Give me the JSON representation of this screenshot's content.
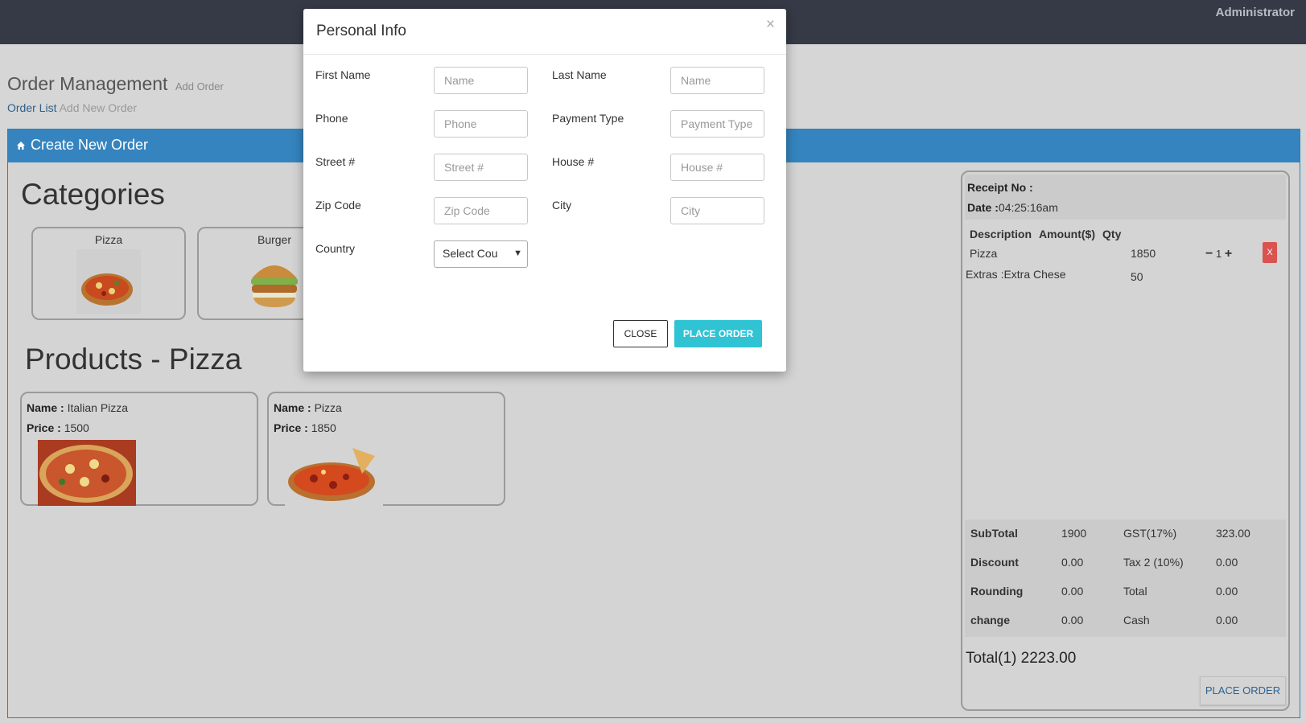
{
  "topbar": {
    "user": "Administrator"
  },
  "page": {
    "title": "Order Management",
    "subtitle": "Add Order",
    "breadcrumb_link": "Order List",
    "breadcrumb_current": "Add New Order"
  },
  "panel": {
    "title": "Create New Order"
  },
  "categories": {
    "title": "Categories",
    "items": [
      {
        "label": "Pizza"
      },
      {
        "label": "Burger"
      }
    ]
  },
  "products": {
    "title": "Products - Pizza",
    "name_label": "Name :",
    "price_label": "Price :",
    "items": [
      {
        "name": "Italian Pizza",
        "price": "1500"
      },
      {
        "name": "Pizza",
        "price": "1850"
      }
    ]
  },
  "receipt": {
    "receipt_no_label": "Receipt No :",
    "date_label": "Date :",
    "date_value": "04:25:16am",
    "col_description": "Description",
    "col_amount": "Amount($)",
    "col_qty": "Qty",
    "line_item": {
      "name": "Pizza",
      "amount": "1850",
      "qty": "1",
      "remove": "X"
    },
    "extras": {
      "label": "Extras :Extra Chese",
      "amount": "50"
    },
    "totals": {
      "subtotal_label": "SubTotal",
      "subtotal": "1900",
      "gst_label": "GST(17%)",
      "gst": "323.00",
      "discount_label": "Discount",
      "discount": "0.00",
      "tax2_label": "Tax 2 (10%)",
      "tax2": "0.00",
      "rounding_label": "Rounding",
      "rounding": "0.00",
      "total_label": "Total",
      "total": "0.00",
      "change_label": "change",
      "change": "0.00",
      "cash_label": "Cash",
      "cash": "0.00"
    },
    "grand_total": "Total(1) 2223.00",
    "place_order": "PLACE ORDER"
  },
  "modal": {
    "title": "Personal Info",
    "close_x": "×",
    "fields": {
      "first_name": {
        "label": "First Name",
        "placeholder": "Name"
      },
      "last_name": {
        "label": "Last Name",
        "placeholder": "Name"
      },
      "phone": {
        "label": "Phone",
        "placeholder": "Phone"
      },
      "payment_type": {
        "label": "Payment Type",
        "placeholder": "Payment Type"
      },
      "street": {
        "label": "Street #",
        "placeholder": "Street #"
      },
      "house": {
        "label": "House #",
        "placeholder": "House #"
      },
      "zip": {
        "label": "Zip Code",
        "placeholder": "Zip Code"
      },
      "city": {
        "label": "City",
        "placeholder": "City"
      },
      "country": {
        "label": "Country",
        "selected": "Select Cou"
      }
    },
    "close_button": "CLOSE",
    "place_order_button": "PLACE ORDER"
  }
}
